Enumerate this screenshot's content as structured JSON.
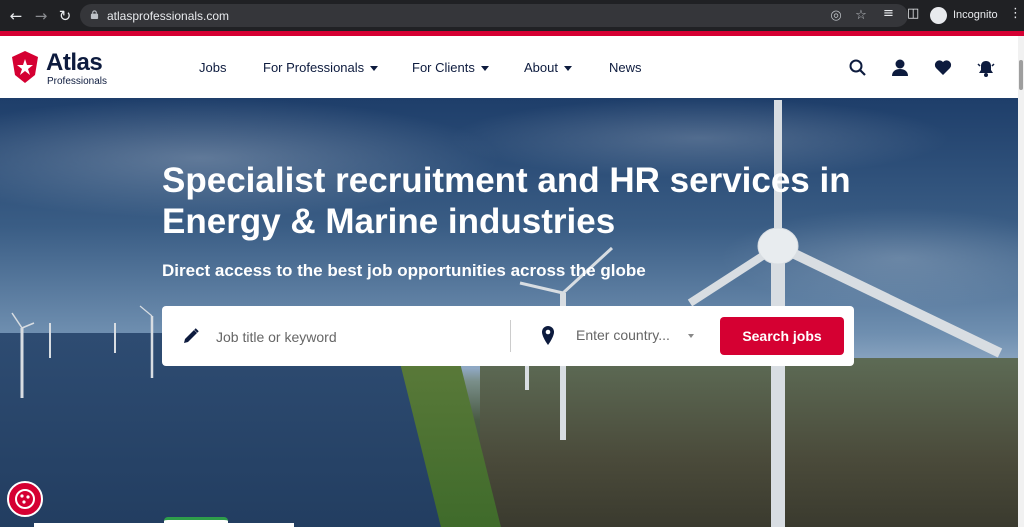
{
  "browser": {
    "url": "atlasprofessionals.com",
    "profile_label": "Incognito",
    "icons": [
      "back-icon",
      "forward-icon",
      "reload-icon",
      "lock-icon",
      "eye-off-icon",
      "star-icon",
      "reading-list-icon",
      "side-panel-icon",
      "incognito-icon",
      "more-icon"
    ]
  },
  "brand": {
    "name": "Atlas",
    "tagline": "Professionals",
    "accent_color": "#d50032",
    "navy_color": "#0d1b3e"
  },
  "nav": {
    "items": [
      {
        "label": "Jobs",
        "has_dropdown": false
      },
      {
        "label": "For Professionals",
        "has_dropdown": true
      },
      {
        "label": "For Clients",
        "has_dropdown": true
      },
      {
        "label": "About",
        "has_dropdown": true
      },
      {
        "label": "News",
        "has_dropdown": false
      }
    ],
    "icons": [
      "search-icon",
      "account-icon",
      "favorites-icon",
      "notifications-icon"
    ]
  },
  "hero": {
    "heading": "Specialist recruitment and HR services in Energy & Marine industries",
    "subheading": "Direct access to the best job opportunities across the globe",
    "search": {
      "keyword_placeholder": "Job title or keyword",
      "country_placeholder": "Enter country...",
      "button_label": "Search jobs"
    }
  }
}
